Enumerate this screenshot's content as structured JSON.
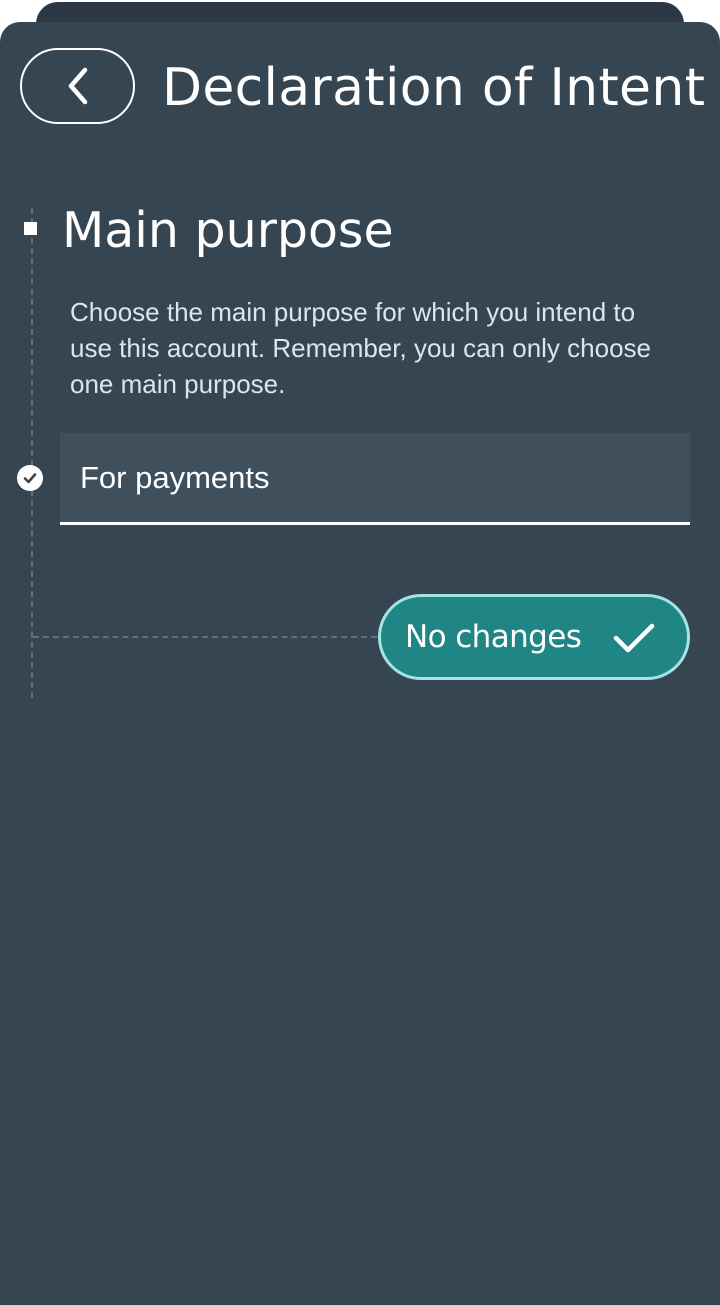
{
  "header": {
    "title": "Declaration of Intent",
    "back_icon": "chevron-left-icon"
  },
  "section": {
    "title": "Main purpose",
    "description": "Choose the main purpose for which you intend to use this account. Remember, you can only choose one main purpose."
  },
  "purpose_select": {
    "value": "For payments",
    "status_icon": "check-circle-icon"
  },
  "actions": {
    "no_changes_label": "No changes",
    "no_changes_icon": "checkmark-icon"
  },
  "colors": {
    "background": "#354552",
    "field_background": "#3f4f5c",
    "button_teal": "#1f8585",
    "button_border": "#a6e4e3",
    "text": "#ffffff"
  }
}
